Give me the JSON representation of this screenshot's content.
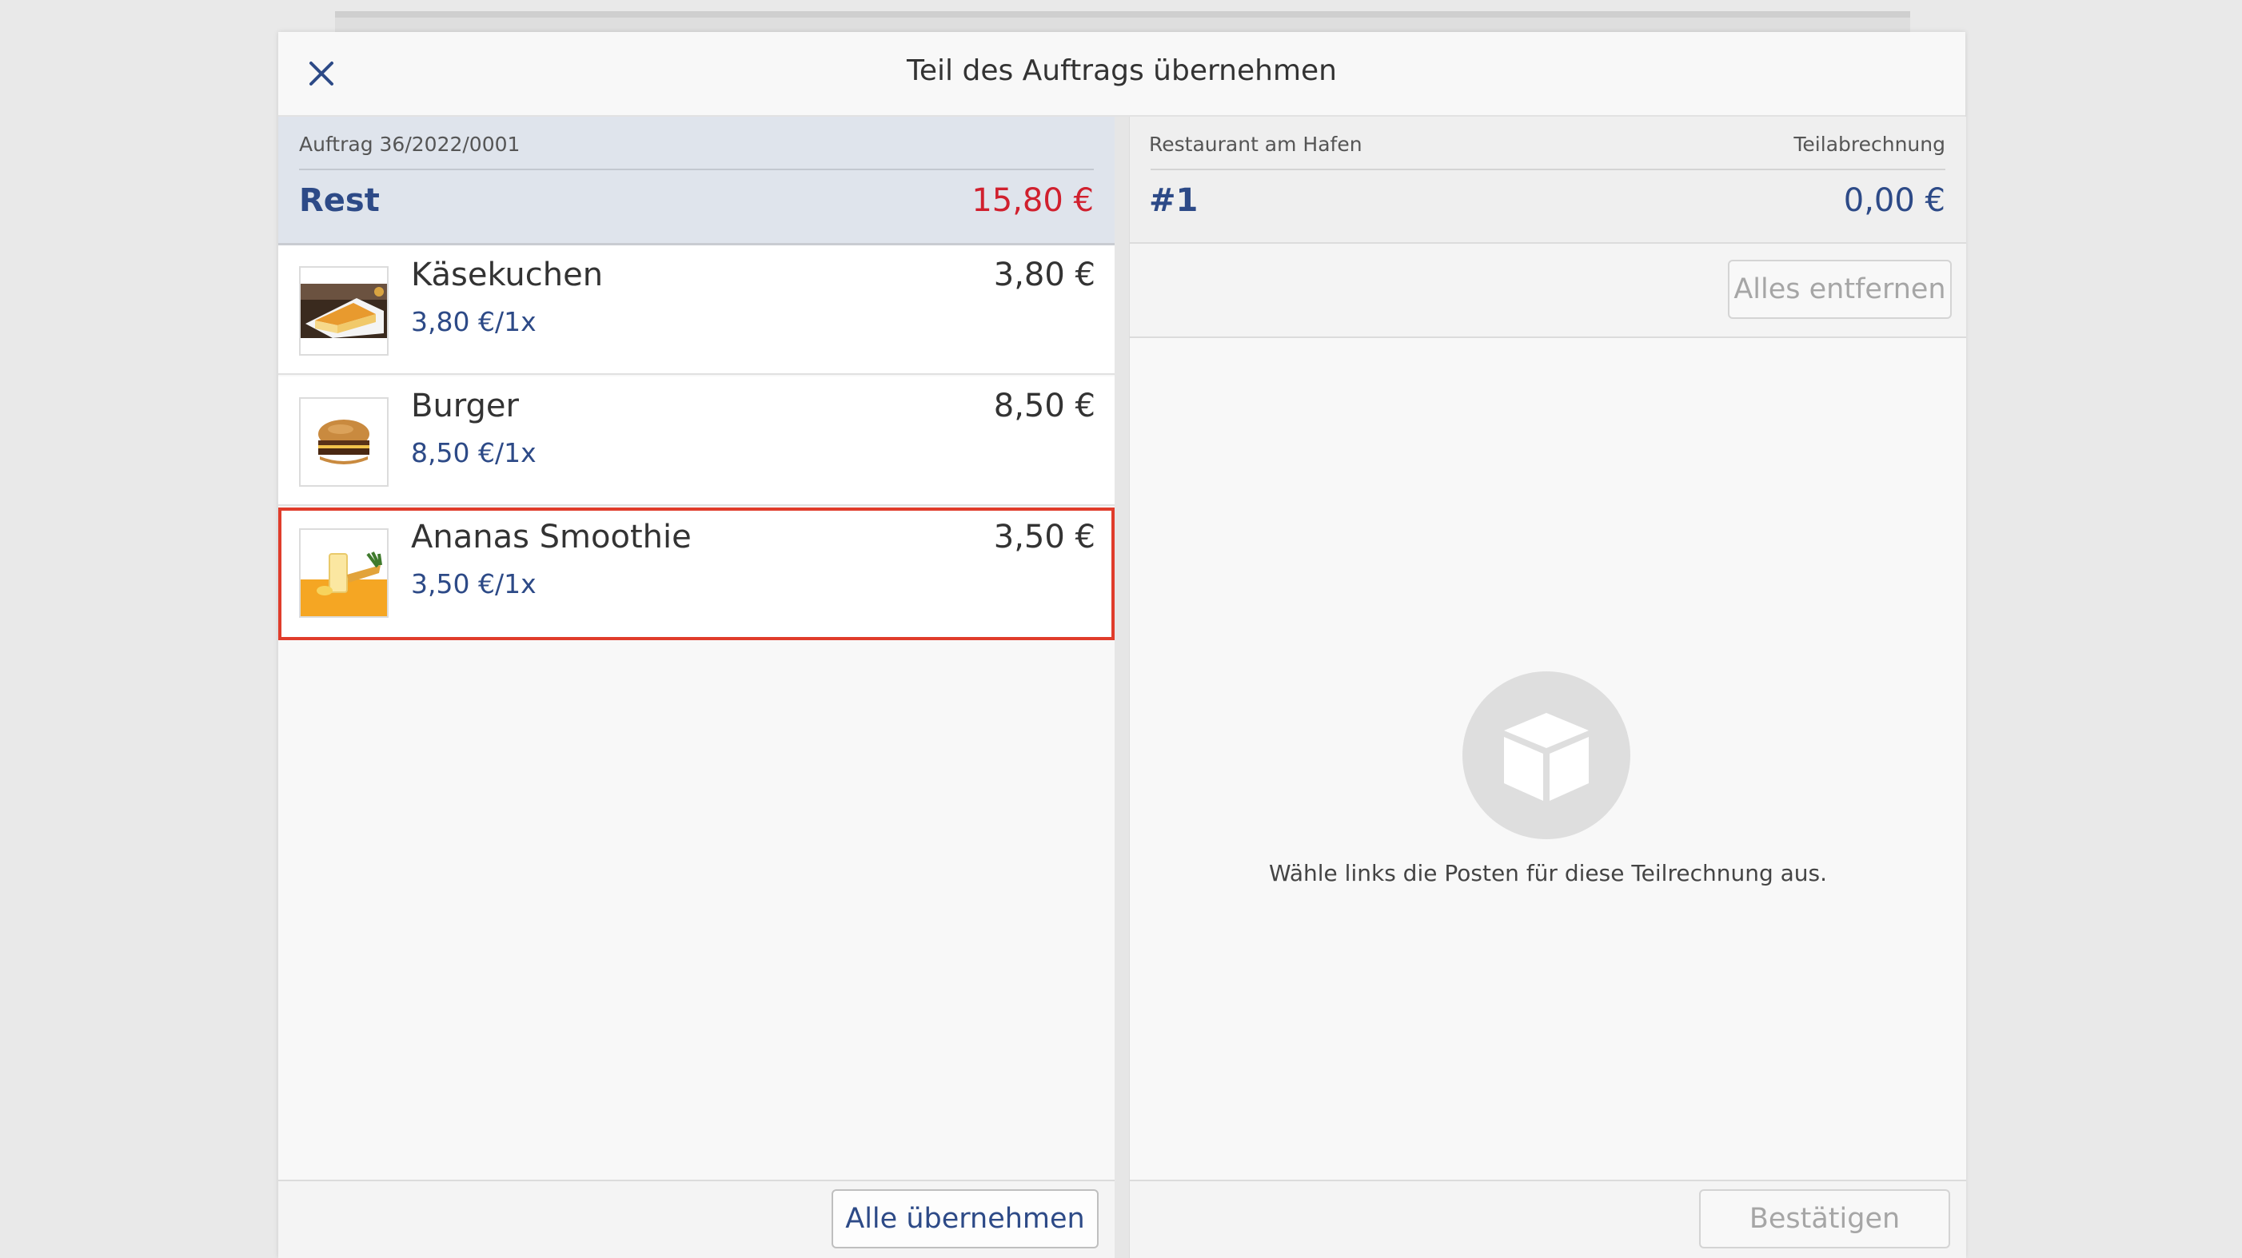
{
  "modal": {
    "title": "Teil des Auftrags übernehmen",
    "close_icon": "close-icon"
  },
  "left": {
    "order_number": "Auftrag 36/2022/0001",
    "rest_label": "Rest",
    "rest_amount": "15,80 €",
    "rest_color": "#d0202e",
    "items": [
      {
        "name": "Käsekuchen",
        "unit_price": "3,80 €/1x",
        "price": "3,80 €",
        "image": "cheesecake-image",
        "selected": false
      },
      {
        "name": "Burger",
        "unit_price": "8,50 €/1x",
        "price": "8,50 €",
        "image": "burger-image",
        "selected": false
      },
      {
        "name": "Ananas Smoothie",
        "unit_price": "3,50 €/1x",
        "price": "3,50 €",
        "image": "smoothie-image",
        "selected": true
      }
    ],
    "take_all_label": "Alle übernehmen"
  },
  "right": {
    "restaurant": "Restaurant am Hafen",
    "type_label": "Teilabrechnung",
    "bill_number": "#1",
    "bill_amount": "0,00 €",
    "remove_all_label": "Alles entfernen",
    "empty_icon": "box-icon",
    "empty_message": "Wähle links die Posten für diese Teilrechnung aus.",
    "confirm_label": "Bestätigen"
  },
  "colors": {
    "accent": "#2d4a87",
    "selection": "#e03c2b",
    "left_header": "#dfe4ec"
  }
}
